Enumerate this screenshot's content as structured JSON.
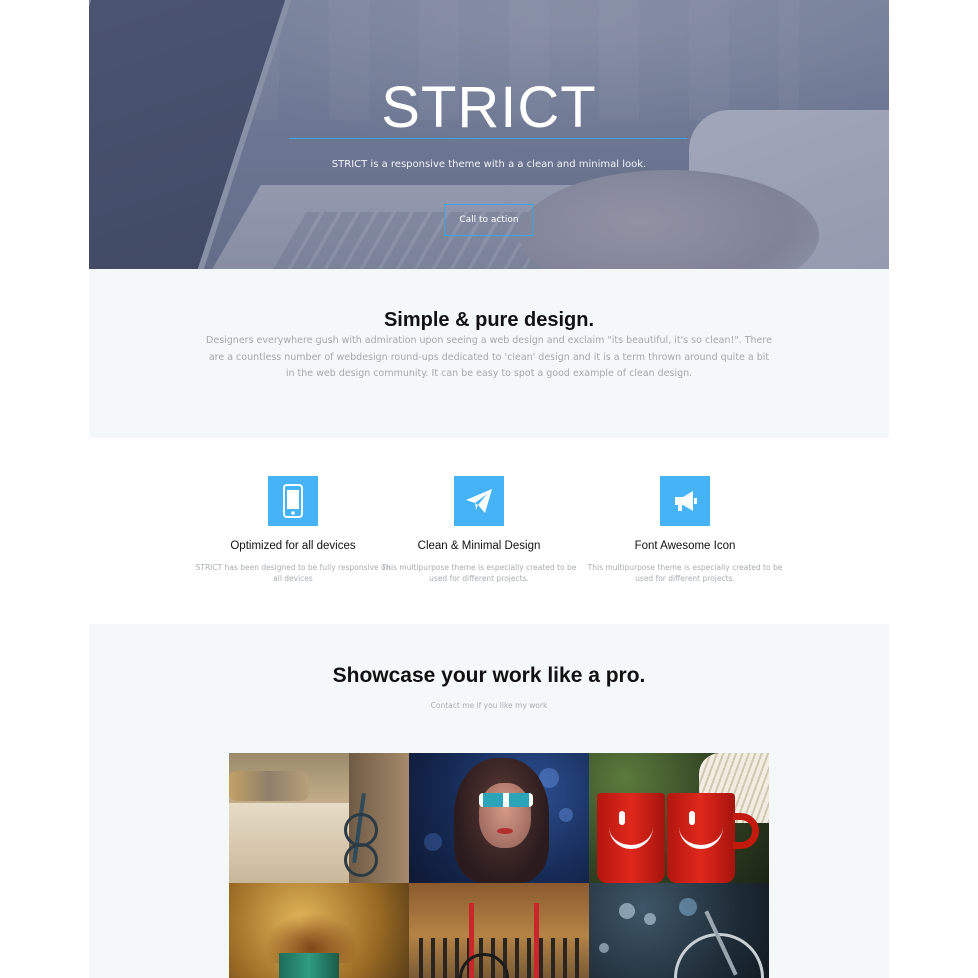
{
  "hero": {
    "title": "STRICT",
    "subtitle": "STRICT is a responsive theme with a a clean and minimal look.",
    "cta_label": "Call to action",
    "accent_color": "#3fa3ea"
  },
  "intro": {
    "title": "Simple & pure design.",
    "text": "Designers everywhere gush with admiration upon seeing a web design and exclaim \"its beautiful, it's so clean!\". There are a countless number of webdesign round-ups dedicated to 'clean' design and it is a term thrown around quite a bit in the web design community. It can be easy to spot a good example of clean design."
  },
  "features": [
    {
      "icon": "mobile-phone-icon",
      "title": "Optimized for all devices",
      "text": "STRICT has been designed to be fully responsive on all devices"
    },
    {
      "icon": "paper-plane-icon",
      "title": "Clean & Minimal Design",
      "text": "This multipurpose theme is especially created to be used for different projects."
    },
    {
      "icon": "bullhorn-icon",
      "title": "Font Awesome Icon",
      "text": "This multipurpose theme is especially created to be used for different projects."
    }
  ],
  "feature_icon_color": "#45b3f5",
  "showcase": {
    "title": "Showcase your work like a pro.",
    "subtitle": "Contact me if you like my work",
    "gallery": [
      {
        "subject": "street-bicycle-photo"
      },
      {
        "subject": "woman-sunglasses-photo"
      },
      {
        "subject": "red-mugs-photo"
      },
      {
        "subject": "splash-cup-photo"
      },
      {
        "subject": "red-bike-photo"
      },
      {
        "subject": "bicycle-bokeh-photo"
      }
    ]
  }
}
